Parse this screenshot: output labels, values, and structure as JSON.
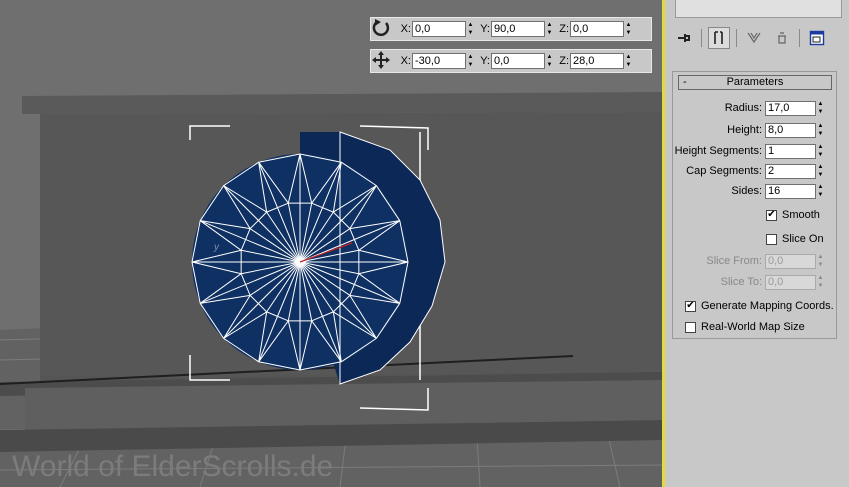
{
  "rotate_typein": {
    "icon": "rotate-icon",
    "x_label": "X:",
    "x_value": "0,0",
    "y_label": "Y:",
    "y_value": "90,0",
    "z_label": "Z:",
    "z_value": "0,0"
  },
  "move_typein": {
    "icon": "move-icon",
    "x_label": "X:",
    "x_value": "-30,0",
    "y_label": "Y:",
    "y_value": "0,0",
    "z_label": "Z:",
    "z_value": "28,0"
  },
  "viewport": {
    "axis_label": "y",
    "watermark": "World of ElderScrolls.de",
    "object_color": "#0f3063",
    "active_border_color": "#e8d838"
  },
  "panel": {
    "tabs": [
      "pin-icon",
      "modifier-stack-icon",
      "funnel-icon",
      "unique-icon",
      "configure-icon"
    ],
    "rollout_title": "Parameters",
    "rollout_collapse": "-",
    "params": {
      "radius_label": "Radius:",
      "radius_value": "17,0",
      "height_label": "Height:",
      "height_value": "8,0",
      "height_segments_label": "Height Segments:",
      "height_segments_value": "1",
      "cap_segments_label": "Cap Segments:",
      "cap_segments_value": "2",
      "sides_label": "Sides:",
      "sides_value": "16",
      "smooth_label": "Smooth",
      "smooth_checked": true,
      "slice_on_label": "Slice On",
      "slice_on_checked": false,
      "slice_from_label": "Slice From:",
      "slice_from_value": "0,0",
      "slice_to_label": "Slice To:",
      "slice_to_value": "0,0",
      "gen_mapping_label": "Generate Mapping Coords.",
      "gen_mapping_checked": true,
      "real_world_label": "Real-World Map Size",
      "real_world_checked": false
    }
  }
}
